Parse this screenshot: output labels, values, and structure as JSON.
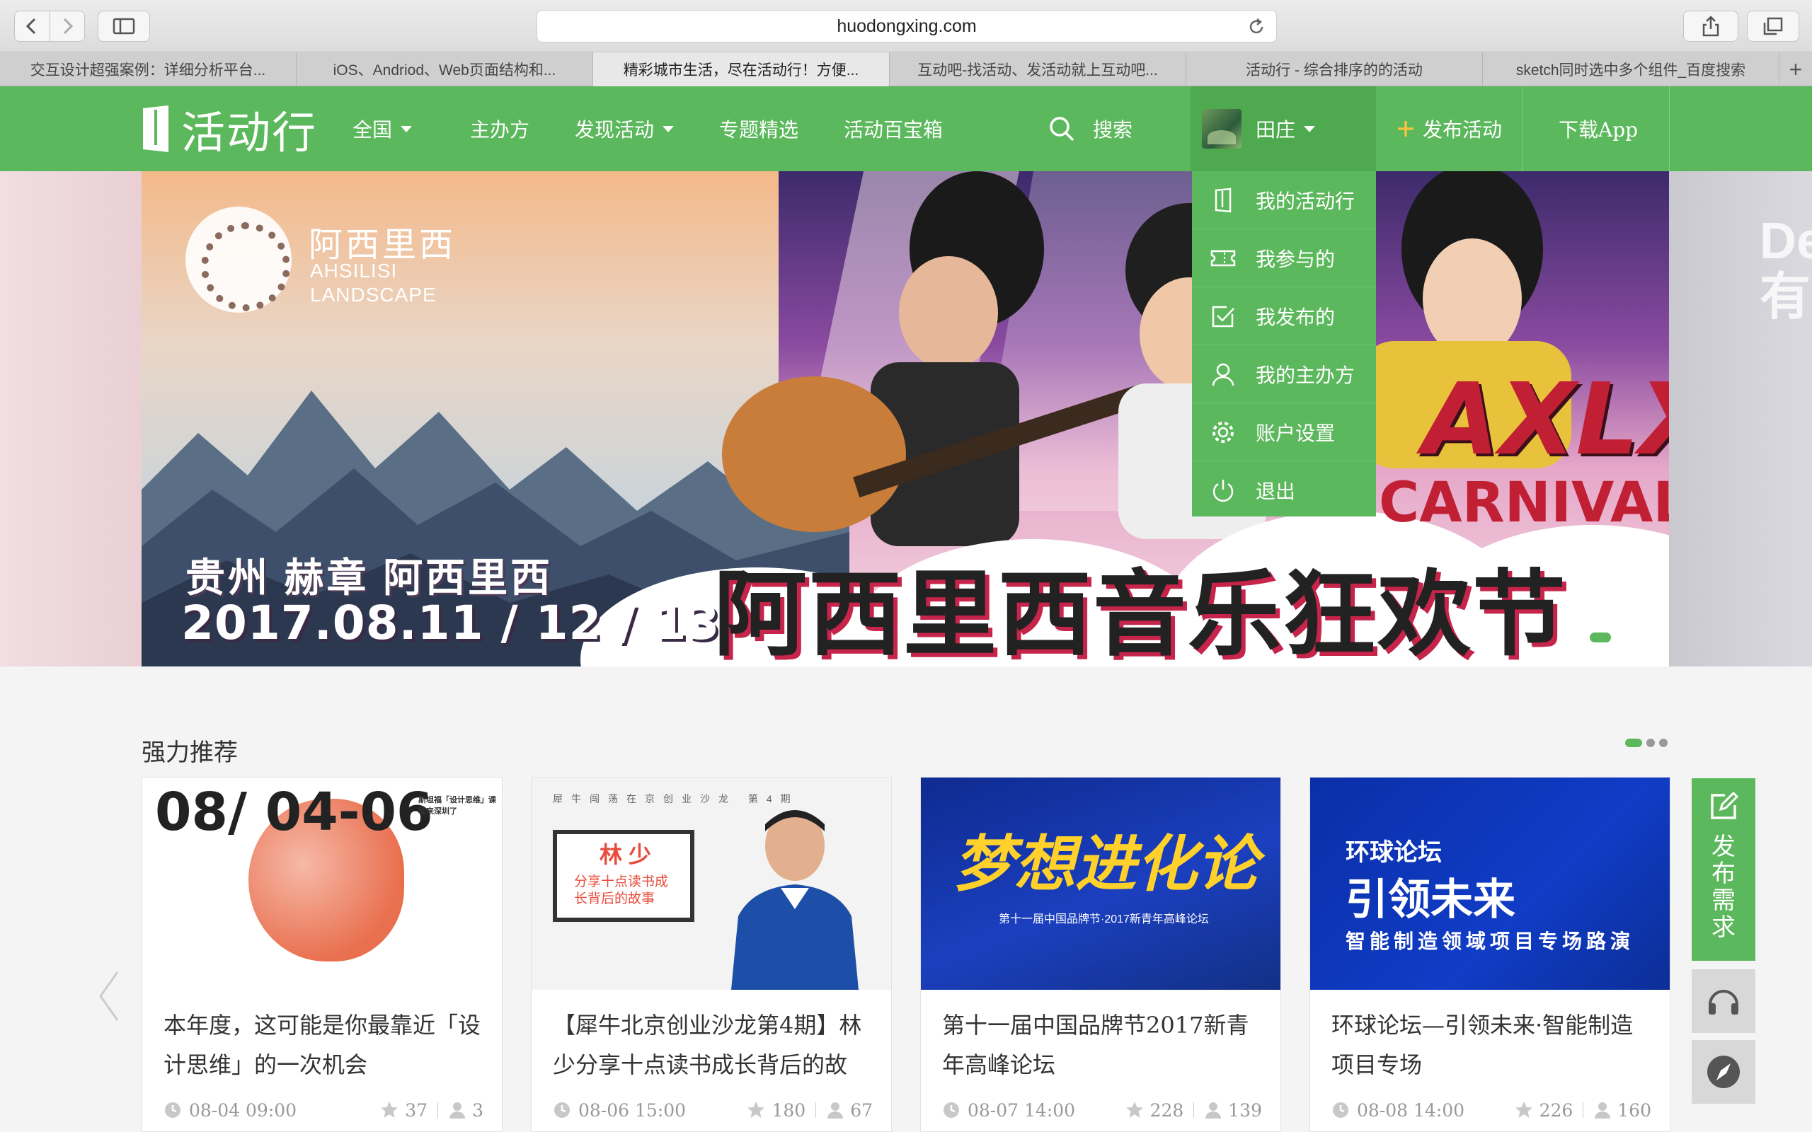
{
  "browser": {
    "url": "huodongxing.com",
    "tabs": [
      {
        "label": "交互设计超强案例：详细分析平台...",
        "active": false
      },
      {
        "label": "iOS、Andriod、Web页面结构和...",
        "active": false
      },
      {
        "label": "精彩城市生活，尽在活动行！方便...",
        "active": true
      },
      {
        "label": "互动吧-找活动、发活动就上互动吧...",
        "active": false
      },
      {
        "label": "活动行 - 综合排序的的活动",
        "active": false
      },
      {
        "label": "sketch同时选中多个组件_百度搜索",
        "active": false
      }
    ]
  },
  "site": {
    "logo": "活动行",
    "nav": {
      "region": "全国",
      "organizer": "主办方",
      "discover": "发现活动",
      "topics": "专题精选",
      "toolbox": "活动百宝箱",
      "search": "搜索",
      "user": "田庄",
      "publish": "发布活动",
      "download": "下载App"
    },
    "accent_color": "#5cb85c",
    "dropdown": [
      {
        "label": "我的活动行",
        "icon": "bookmark-icon"
      },
      {
        "label": "我参与的",
        "icon": "ticket-icon"
      },
      {
        "label": "我发布的",
        "icon": "check-square-icon"
      },
      {
        "label": "我的主办方",
        "icon": "user-icon"
      },
      {
        "label": "账户设置",
        "icon": "gear-icon"
      },
      {
        "label": "退出",
        "icon": "power-icon"
      }
    ]
  },
  "banner": {
    "brand_cn": "阿西里西",
    "brand_en_1": "AHSILISI",
    "brand_en_2": "LANDSCAPE",
    "location": "贵州 赫章 阿西里西",
    "dates": "2017.08.11 / 12 / 13",
    "headline": "阿西里西音乐狂欢节",
    "axlx": "AXLX",
    "carnival": "CARNIVAL",
    "side_text": "De 有",
    "slide_count": 3,
    "active_slide": 1
  },
  "recommend": {
    "title": "强力推荐",
    "cards": [
      {
        "title": "本年度，这可能是你最靠近「设计思维」的一次机会",
        "time": "08-04 09:00",
        "stars": "37",
        "people": "3",
        "img_date": "08/ 04-06",
        "img_side": "斯坦福「设计思维」课程来深圳了"
      },
      {
        "title": "【犀牛北京创业沙龙第4期】林少分享十点读书成长背后的故",
        "time": "08-06 15:00",
        "stars": "180",
        "people": "67",
        "img_header": "犀牛闯荡在京创业沙龙 第4期",
        "img_name": "林 少",
        "img_sub": "分享十点读书成长背后的故事"
      },
      {
        "title": "第十一届中国品牌节2017新青年高峰论坛",
        "time": "08-07 14:00",
        "stars": "228",
        "people": "139",
        "img_title": "梦想进化论",
        "img_sub": "第十一届中国品牌节·2017新青年高峰论坛"
      },
      {
        "title": "环球论坛—引领未来·智能制造项目专场",
        "time": "08-08 14:00",
        "stars": "226",
        "people": "160",
        "img_a": "环球论坛",
        "img_b": "引领未来",
        "img_c": "智能制造领域项目专场路演"
      }
    ]
  },
  "float": {
    "post_demand": "发布需求"
  }
}
